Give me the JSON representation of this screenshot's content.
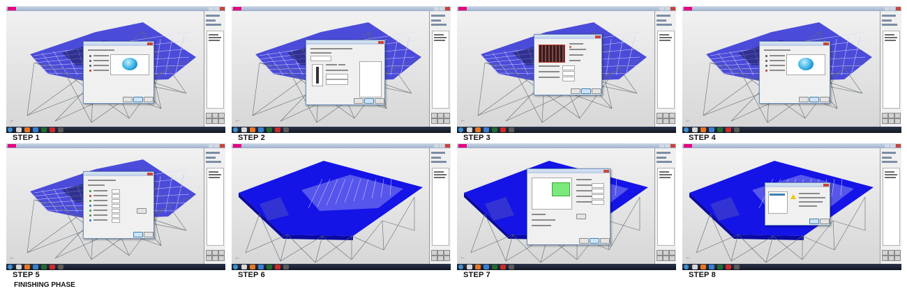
{
  "steps": [
    {
      "label": "STEP 1",
      "model": "frame",
      "dialog": "options",
      "icon": "sphere-icon"
    },
    {
      "label": "STEP 2",
      "model": "frame",
      "dialog": "selection",
      "icon": "clamp-icon"
    },
    {
      "label": "STEP 3",
      "model": "frame",
      "dialog": "image",
      "icon": "image-icon"
    },
    {
      "label": "STEP 4",
      "model": "frame",
      "dialog": "options",
      "icon": "sphere-icon"
    },
    {
      "label": "STEP 5",
      "model": "frame",
      "dialog": "list",
      "icon": "none"
    },
    {
      "label": "STEP 6",
      "model": "surface",
      "dialog": "none",
      "icon": "none"
    },
    {
      "label": "STEP 7",
      "model": "surface",
      "dialog": "preview",
      "icon": "green-panel-icon"
    },
    {
      "label": "STEP 8",
      "model": "surface",
      "dialog": "warning",
      "icon": "warning-icon"
    }
  ],
  "footer": {
    "phase_label": "FINISHING PHASE"
  },
  "colors": {
    "frame_fill": "#3a3ad8",
    "surface_fill": "#1414e6",
    "strut": "#606a72",
    "accent_green": "#7de87d",
    "warning_yellow": "#f3c400",
    "brand_magenta": "#e6007e"
  }
}
